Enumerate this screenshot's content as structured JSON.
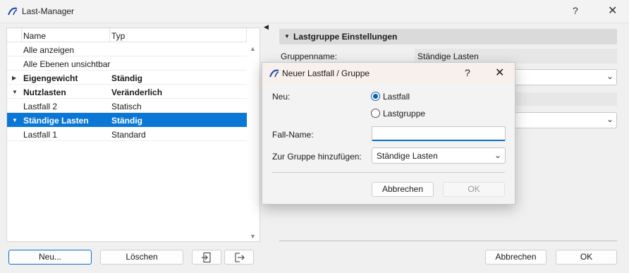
{
  "window": {
    "title": "Last-Manager",
    "help": "?",
    "close": "✕"
  },
  "tree": {
    "col_name": "Name",
    "col_typ": "Typ",
    "rows": [
      {
        "name": "Alle anzeigen",
        "typ": ""
      },
      {
        "name": "Alle Ebenen unsichtbar",
        "typ": ""
      },
      {
        "name": "Eigengewicht",
        "typ": "Ständig"
      },
      {
        "name": "Nutzlasten",
        "typ": "Veränderlich"
      },
      {
        "name": "Lastfall 2",
        "typ": "Statisch"
      },
      {
        "name": "Ständige Lasten",
        "typ": "Ständig"
      },
      {
        "name": "Lastfall 1",
        "typ": "Standard"
      }
    ]
  },
  "left_buttons": {
    "new": "Neu...",
    "delete": "Löschen"
  },
  "right": {
    "section_title": "Lastgruppe Einstellungen",
    "group_name_label": "Gruppenname:",
    "group_name_value": "Ständige Lasten"
  },
  "bottom_buttons": {
    "cancel": "Abbrechen",
    "ok": "OK"
  },
  "dialog": {
    "title": "Neuer Lastfall / Gruppe",
    "help": "?",
    "close": "✕",
    "neu_label": "Neu:",
    "radio_lastfall": "Lastfall",
    "radio_lastgruppe": "Lastgruppe",
    "selected": "Lastfall",
    "fall_name_label": "Fall-Name:",
    "fall_name_value": "",
    "group_label": "Zur Gruppe hinzufügen:",
    "group_value": "Ständige Lasten",
    "cancel": "Abbrechen",
    "ok": "OK"
  }
}
